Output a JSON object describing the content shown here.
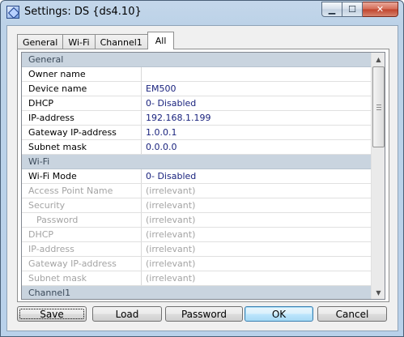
{
  "window": {
    "title": "Settings: DS {ds4.10}",
    "minimize_glyph": "▁",
    "maximize_glyph": "☐",
    "close_glyph": "✕"
  },
  "tabs": [
    {
      "label": "General"
    },
    {
      "label": "Wi-Fi"
    },
    {
      "label": "Channel1"
    },
    {
      "label": "All"
    }
  ],
  "active_tab": "All",
  "grid": {
    "rows": [
      {
        "type": "section",
        "name": "General"
      },
      {
        "type": "item",
        "name": "Owner name",
        "value": "",
        "enabled": true
      },
      {
        "type": "item",
        "name": "Device name",
        "value": "EM500",
        "enabled": true
      },
      {
        "type": "item",
        "name": "DHCP",
        "value": "0- Disabled",
        "enabled": true
      },
      {
        "type": "item",
        "name": "IP-address",
        "value": "192.168.1.199",
        "enabled": true
      },
      {
        "type": "item",
        "name": "Gateway IP-address",
        "value": "1.0.0.1",
        "enabled": true
      },
      {
        "type": "item",
        "name": "Subnet mask",
        "value": "0.0.0.0",
        "enabled": true
      },
      {
        "type": "section",
        "name": "Wi-Fi"
      },
      {
        "type": "item",
        "name": "Wi-Fi Mode",
        "value": "0- Disabled",
        "enabled": true
      },
      {
        "type": "item",
        "name": "Access Point Name",
        "value": "(irrelevant)",
        "enabled": false
      },
      {
        "type": "item",
        "name": "Security",
        "value": "(irrelevant)",
        "enabled": false
      },
      {
        "type": "item",
        "name": "Password",
        "value": "(irrelevant)",
        "enabled": false,
        "indent": true
      },
      {
        "type": "item",
        "name": "DHCP",
        "value": "(irrelevant)",
        "enabled": false
      },
      {
        "type": "item",
        "name": "IP-address",
        "value": "(irrelevant)",
        "enabled": false
      },
      {
        "type": "item",
        "name": "Gateway IP-address",
        "value": "(irrelevant)",
        "enabled": false
      },
      {
        "type": "item",
        "name": "Subnet mask",
        "value": "(irrelevant)",
        "enabled": false
      },
      {
        "type": "section",
        "name": "Channel1"
      }
    ]
  },
  "buttons": {
    "save": "Save",
    "load": "Load",
    "password": "Password",
    "ok": "OK",
    "cancel": "Cancel"
  },
  "scrollbar": {
    "up_glyph": "▲",
    "down_glyph": "▼"
  },
  "colors": {
    "section_bg": "#c9d4df",
    "value_text": "#1a237e",
    "disabled_text": "#a4a4a4"
  }
}
